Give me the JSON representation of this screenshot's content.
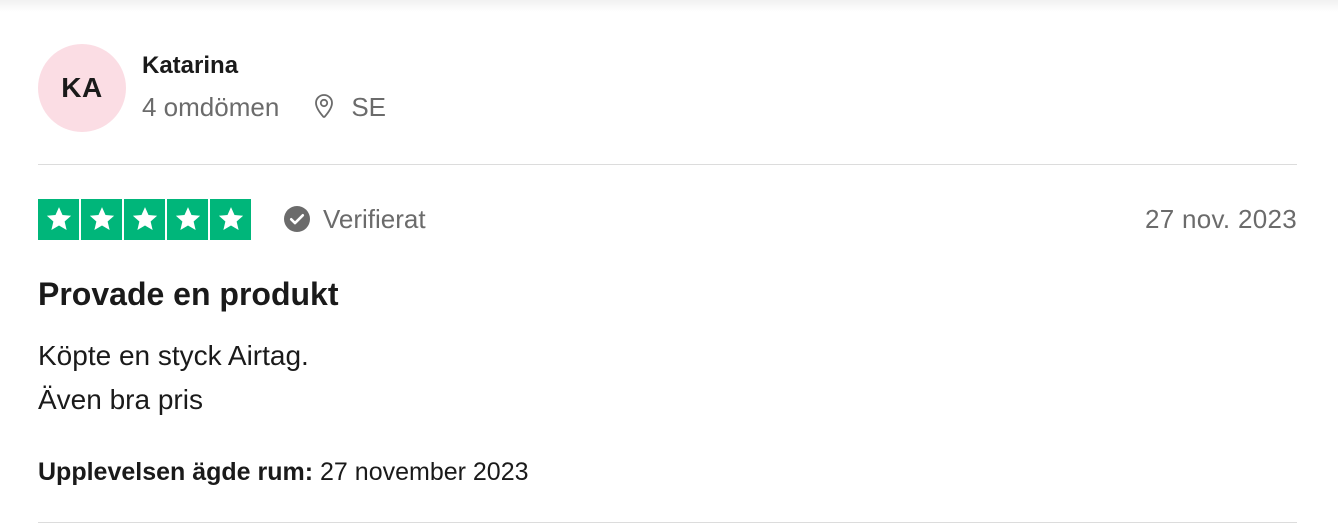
{
  "consumer": {
    "initials": "KA",
    "name": "Katarina",
    "reviews_count": "4 omdömen",
    "country": "SE",
    "avatar_color": "#fbdde4"
  },
  "review": {
    "rating": 5,
    "max_rating": 5,
    "star_color": "#00b67a",
    "verified_label": "Verifierat",
    "date": "27 nov. 2023",
    "title": "Provade en produkt",
    "body_lines": [
      "Köpte en styck Airtag.",
      "Även bra pris"
    ],
    "experience_label": "Upplevelsen ägde rum:",
    "experience_date": "27 november 2023"
  },
  "icons": {
    "location": "map-pin-icon",
    "verified": "check-circle-icon",
    "star": "star-icon"
  }
}
